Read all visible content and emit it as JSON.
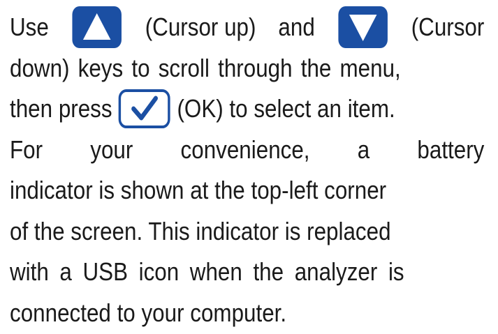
{
  "paragraph": {
    "line1": {
      "w1": "Use",
      "up_caption": "(Cursor up)",
      "w_and": "and",
      "down_caption": "(Cursor"
    },
    "line2": "down) keys to scroll through the menu,",
    "line3": {
      "before": "then press",
      "after": "(OK) to select an item."
    },
    "line4": [
      "For",
      "your",
      "convenience,",
      "a",
      "battery"
    ],
    "line5": "indicator is shown at the top-left corner",
    "line6": "of the screen. This indicator is replaced",
    "line7": "with a USB icon when the analyzer is",
    "line8": "connected to your computer."
  },
  "icons": {
    "up_key": "cursor-up-key",
    "down_key": "cursor-down-key",
    "ok_key": "ok-check-key"
  },
  "colors": {
    "key_blue": "#1b4fa3",
    "text": "#1a1a1a"
  }
}
